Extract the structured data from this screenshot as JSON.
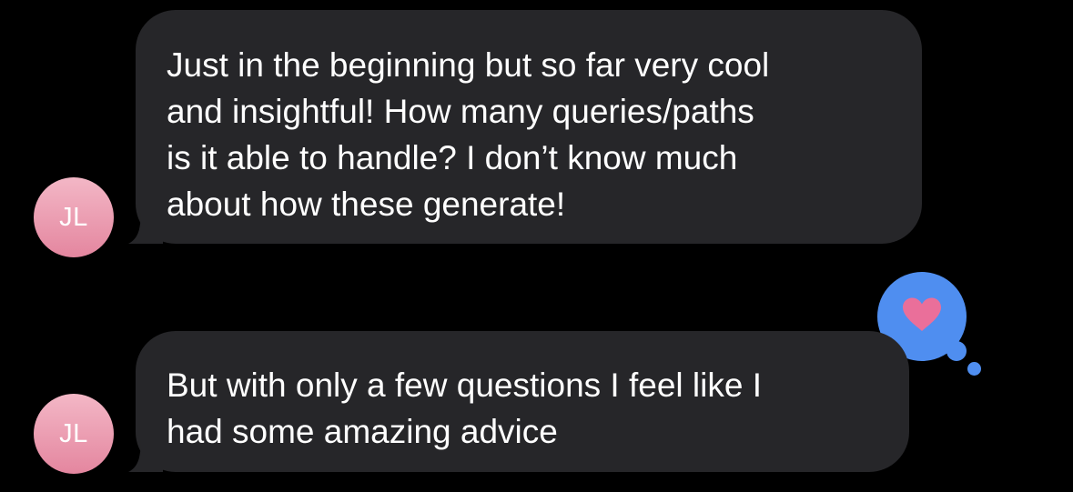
{
  "messages": [
    {
      "sender_initials": "JL",
      "lines": [
        "Just in the beginning but so far very cool",
        "and insightful! How many queries/paths",
        "is it able to handle? I don’t know much",
        "about how these generate!"
      ]
    },
    {
      "sender_initials": "JL",
      "lines": [
        "But with only a few questions I feel like I",
        "had some amazing advice"
      ],
      "tapback": "heart-icon"
    }
  ],
  "colors": {
    "background": "#000000",
    "bubble": "#262629",
    "text": "#ffffff",
    "avatar_top": "#f3b7c6",
    "avatar_bottom": "#e4869f",
    "tapback_blue": "#4f8ef0",
    "heart_pink": "#ea6f9a"
  }
}
